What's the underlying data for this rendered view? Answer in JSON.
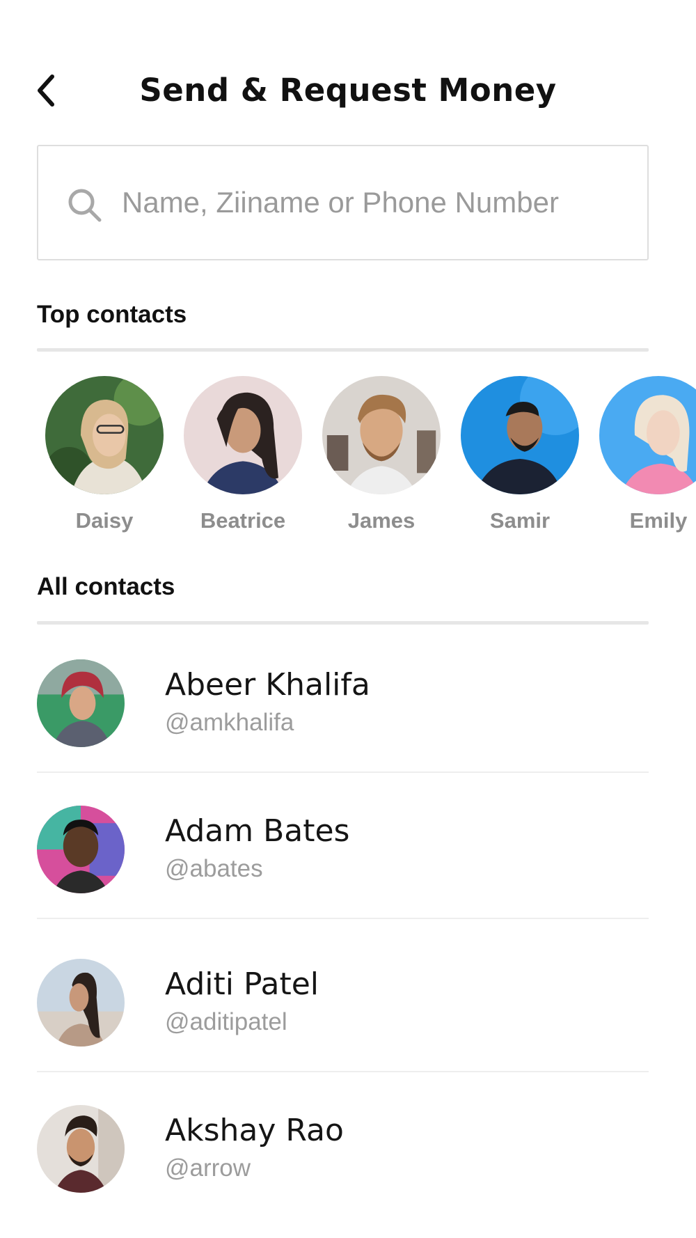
{
  "header": {
    "back_icon": "chevron-left-icon",
    "title": "Send & Request Money"
  },
  "search": {
    "icon": "search-icon",
    "placeholder": "Name, Ziiname or Phone Number",
    "value": ""
  },
  "top_contacts": {
    "heading": "Top contacts",
    "items": [
      {
        "name": "Daisy"
      },
      {
        "name": "Beatrice"
      },
      {
        "name": "James"
      },
      {
        "name": "Samir"
      },
      {
        "name": "Emily"
      }
    ]
  },
  "all_contacts": {
    "heading": "All contacts",
    "items": [
      {
        "name": "Abeer Khalifa",
        "handle": "@amkhalifa"
      },
      {
        "name": "Adam Bates",
        "handle": "@abates"
      },
      {
        "name": "Aditi Patel",
        "handle": "@aditipatel"
      },
      {
        "name": "Akshay Rao",
        "handle": "@arrow"
      }
    ]
  },
  "colors": {
    "text_primary": "#111111",
    "text_muted": "#8d8d8d",
    "divider": "#e6e6e6",
    "search_border": "#dedede"
  }
}
